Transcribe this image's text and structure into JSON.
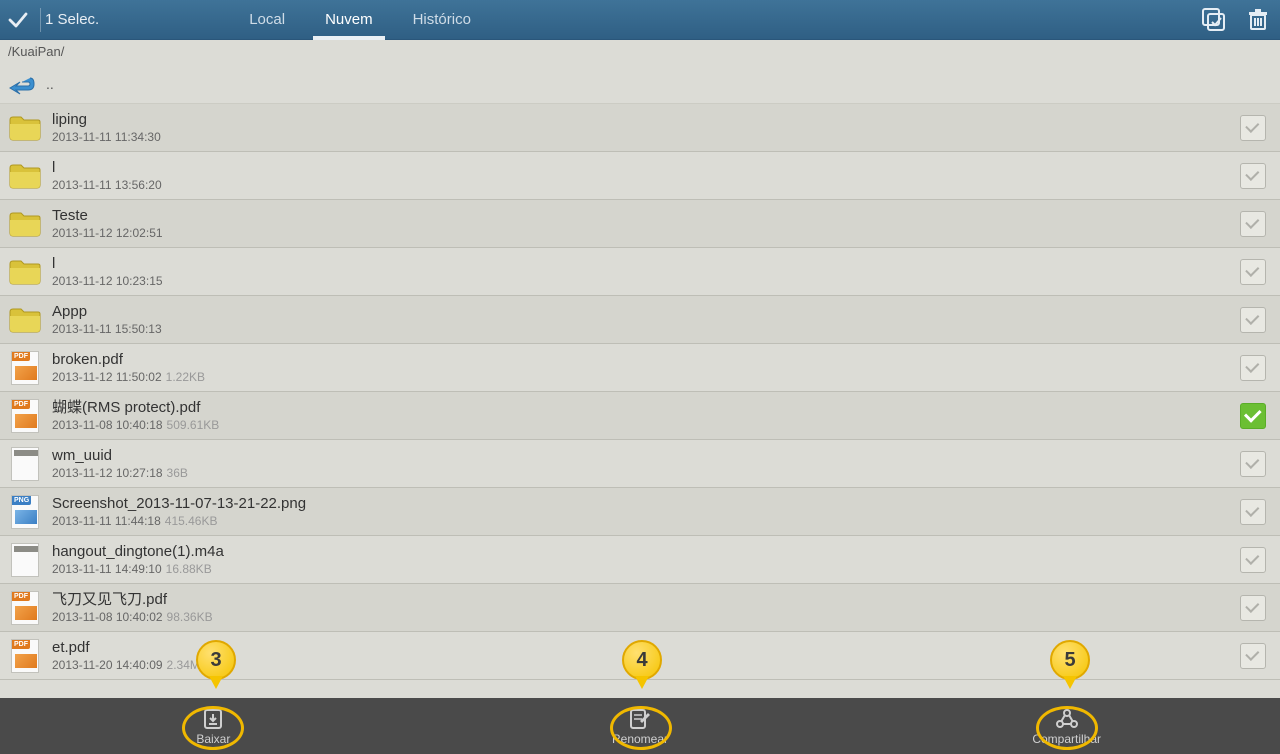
{
  "header": {
    "selection_text": "1 Selec.",
    "tabs": {
      "local": "Local",
      "nuvem": "Nuvem",
      "historico": "Histórico"
    },
    "active_tab": "nuvem"
  },
  "breadcrumb": "/KuaiPan/",
  "up_label": "..",
  "files": [
    {
      "name": "liping",
      "date": "2013-11-11 11:34:30",
      "type": "folder",
      "selected": false
    },
    {
      "name": "l",
      "date": "2013-11-11 13:56:20",
      "type": "folder",
      "selected": false
    },
    {
      "name": "Teste",
      "date": "2013-11-12 12:02:51",
      "type": "folder",
      "selected": false
    },
    {
      "name": "l",
      "date": "2013-11-12 10:23:15",
      "type": "folder",
      "selected": false
    },
    {
      "name": "Appp",
      "date": "2013-11-11 15:50:13",
      "type": "folder",
      "selected": false
    },
    {
      "name": "broken.pdf",
      "date": "2013-11-12 11:50:02",
      "size": "1.22KB",
      "type": "pdf",
      "selected": false
    },
    {
      "name": "蝴蝶(RMS protect).pdf",
      "date": "2013-11-08 10:40:18",
      "size": "509.61KB",
      "type": "pdf",
      "selected": true
    },
    {
      "name": "wm_uuid",
      "date": "2013-11-12 10:27:18",
      "size": "36B",
      "type": "blank",
      "selected": false
    },
    {
      "name": "Screenshot_2013-11-07-13-21-22.png",
      "date": "2013-11-11 11:44:18",
      "size": "415.46KB",
      "type": "png",
      "selected": false
    },
    {
      "name": "hangout_dingtone(1).m4a",
      "date": "2013-11-11 14:49:10",
      "size": "16.88KB",
      "type": "blank",
      "selected": false
    },
    {
      "name": "飞刀又见飞刀.pdf",
      "date": "2013-11-08 10:40:02",
      "size": "98.36KB",
      "type": "pdf",
      "selected": false
    },
    {
      "name": "et.pdf",
      "date": "2013-11-20 14:40:09",
      "size": "2.34MB",
      "type": "pdf",
      "selected": false
    }
  ],
  "actions": {
    "download": "Baixar",
    "rename": "Renomear",
    "share": "Compartilhar"
  },
  "annotations": {
    "a3": "3",
    "a4": "4",
    "a5": "5"
  }
}
